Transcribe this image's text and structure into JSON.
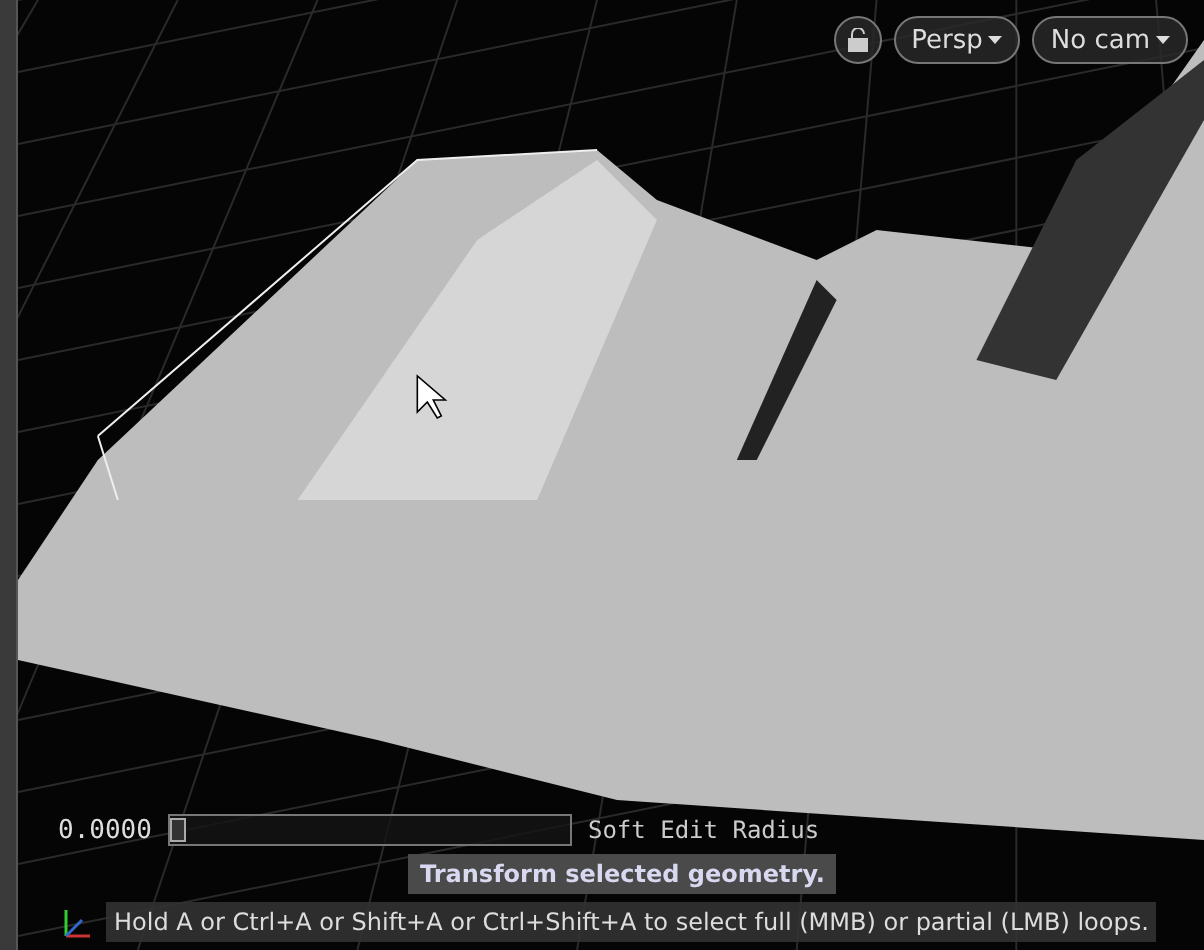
{
  "viewport": {
    "camera_buttons": [
      {
        "label": "Persp"
      },
      {
        "label": "No cam"
      }
    ]
  },
  "hud": {
    "slider": {
      "value": "0.0000",
      "level": 0.0,
      "label": "Soft Edit Radius"
    },
    "tooltip": "Transform selected geometry.",
    "hint": "Hold A or Ctrl+A or Shift+A or Ctrl+Shift+A to select full (MMB) or partial (LMB) loops."
  }
}
